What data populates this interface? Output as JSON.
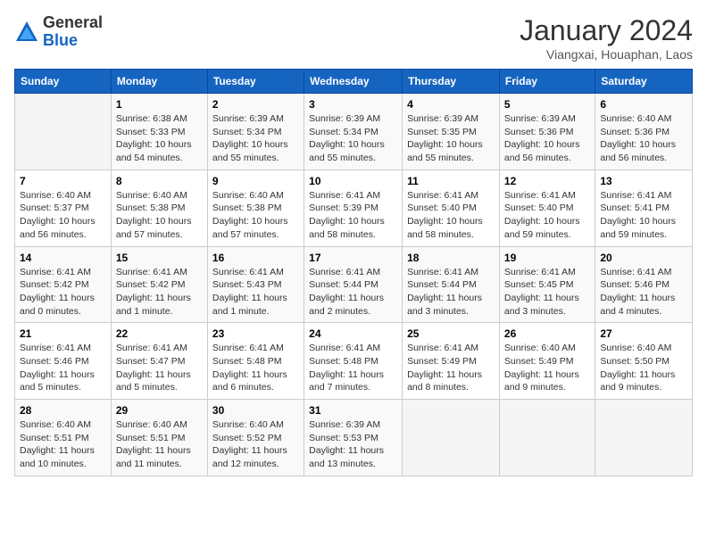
{
  "logo": {
    "general": "General",
    "blue": "Blue"
  },
  "title": "January 2024",
  "subtitle": "Viangxai, Houaphan, Laos",
  "headers": [
    "Sunday",
    "Monday",
    "Tuesday",
    "Wednesday",
    "Thursday",
    "Friday",
    "Saturday"
  ],
  "weeks": [
    [
      {
        "day": "",
        "info": ""
      },
      {
        "day": "1",
        "info": "Sunrise: 6:38 AM\nSunset: 5:33 PM\nDaylight: 10 hours\nand 54 minutes."
      },
      {
        "day": "2",
        "info": "Sunrise: 6:39 AM\nSunset: 5:34 PM\nDaylight: 10 hours\nand 55 minutes."
      },
      {
        "day": "3",
        "info": "Sunrise: 6:39 AM\nSunset: 5:34 PM\nDaylight: 10 hours\nand 55 minutes."
      },
      {
        "day": "4",
        "info": "Sunrise: 6:39 AM\nSunset: 5:35 PM\nDaylight: 10 hours\nand 55 minutes."
      },
      {
        "day": "5",
        "info": "Sunrise: 6:39 AM\nSunset: 5:36 PM\nDaylight: 10 hours\nand 56 minutes."
      },
      {
        "day": "6",
        "info": "Sunrise: 6:40 AM\nSunset: 5:36 PM\nDaylight: 10 hours\nand 56 minutes."
      }
    ],
    [
      {
        "day": "7",
        "info": "Sunrise: 6:40 AM\nSunset: 5:37 PM\nDaylight: 10 hours\nand 56 minutes."
      },
      {
        "day": "8",
        "info": "Sunrise: 6:40 AM\nSunset: 5:38 PM\nDaylight: 10 hours\nand 57 minutes."
      },
      {
        "day": "9",
        "info": "Sunrise: 6:40 AM\nSunset: 5:38 PM\nDaylight: 10 hours\nand 57 minutes."
      },
      {
        "day": "10",
        "info": "Sunrise: 6:41 AM\nSunset: 5:39 PM\nDaylight: 10 hours\nand 58 minutes."
      },
      {
        "day": "11",
        "info": "Sunrise: 6:41 AM\nSunset: 5:40 PM\nDaylight: 10 hours\nand 58 minutes."
      },
      {
        "day": "12",
        "info": "Sunrise: 6:41 AM\nSunset: 5:40 PM\nDaylight: 10 hours\nand 59 minutes."
      },
      {
        "day": "13",
        "info": "Sunrise: 6:41 AM\nSunset: 5:41 PM\nDaylight: 10 hours\nand 59 minutes."
      }
    ],
    [
      {
        "day": "14",
        "info": "Sunrise: 6:41 AM\nSunset: 5:42 PM\nDaylight: 11 hours\nand 0 minutes."
      },
      {
        "day": "15",
        "info": "Sunrise: 6:41 AM\nSunset: 5:42 PM\nDaylight: 11 hours\nand 1 minute."
      },
      {
        "day": "16",
        "info": "Sunrise: 6:41 AM\nSunset: 5:43 PM\nDaylight: 11 hours\nand 1 minute."
      },
      {
        "day": "17",
        "info": "Sunrise: 6:41 AM\nSunset: 5:44 PM\nDaylight: 11 hours\nand 2 minutes."
      },
      {
        "day": "18",
        "info": "Sunrise: 6:41 AM\nSunset: 5:44 PM\nDaylight: 11 hours\nand 3 minutes."
      },
      {
        "day": "19",
        "info": "Sunrise: 6:41 AM\nSunset: 5:45 PM\nDaylight: 11 hours\nand 3 minutes."
      },
      {
        "day": "20",
        "info": "Sunrise: 6:41 AM\nSunset: 5:46 PM\nDaylight: 11 hours\nand 4 minutes."
      }
    ],
    [
      {
        "day": "21",
        "info": "Sunrise: 6:41 AM\nSunset: 5:46 PM\nDaylight: 11 hours\nand 5 minutes."
      },
      {
        "day": "22",
        "info": "Sunrise: 6:41 AM\nSunset: 5:47 PM\nDaylight: 11 hours\nand 5 minutes."
      },
      {
        "day": "23",
        "info": "Sunrise: 6:41 AM\nSunset: 5:48 PM\nDaylight: 11 hours\nand 6 minutes."
      },
      {
        "day": "24",
        "info": "Sunrise: 6:41 AM\nSunset: 5:48 PM\nDaylight: 11 hours\nand 7 minutes."
      },
      {
        "day": "25",
        "info": "Sunrise: 6:41 AM\nSunset: 5:49 PM\nDaylight: 11 hours\nand 8 minutes."
      },
      {
        "day": "26",
        "info": "Sunrise: 6:40 AM\nSunset: 5:49 PM\nDaylight: 11 hours\nand 9 minutes."
      },
      {
        "day": "27",
        "info": "Sunrise: 6:40 AM\nSunset: 5:50 PM\nDaylight: 11 hours\nand 9 minutes."
      }
    ],
    [
      {
        "day": "28",
        "info": "Sunrise: 6:40 AM\nSunset: 5:51 PM\nDaylight: 11 hours\nand 10 minutes."
      },
      {
        "day": "29",
        "info": "Sunrise: 6:40 AM\nSunset: 5:51 PM\nDaylight: 11 hours\nand 11 minutes."
      },
      {
        "day": "30",
        "info": "Sunrise: 6:40 AM\nSunset: 5:52 PM\nDaylight: 11 hours\nand 12 minutes."
      },
      {
        "day": "31",
        "info": "Sunrise: 6:39 AM\nSunset: 5:53 PM\nDaylight: 11 hours\nand 13 minutes."
      },
      {
        "day": "",
        "info": ""
      },
      {
        "day": "",
        "info": ""
      },
      {
        "day": "",
        "info": ""
      }
    ]
  ]
}
